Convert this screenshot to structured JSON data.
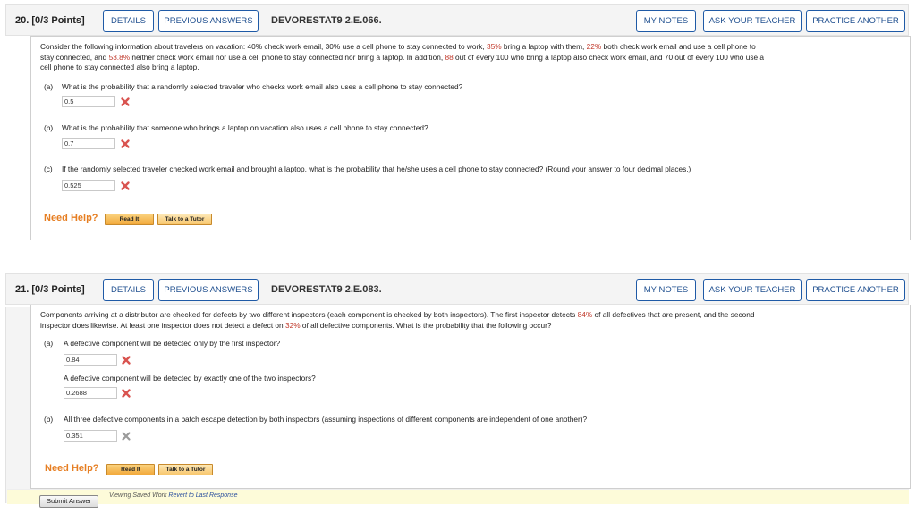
{
  "header_buttons": {
    "details": "DETAILS",
    "previous_answers": "PREVIOUS ANSWERS",
    "my_notes": "MY NOTES",
    "ask_teacher": "ASK YOUR TEACHER",
    "practice_another": "PRACTICE ANOTHER"
  },
  "need_help": {
    "label": "Need Help?",
    "read_it": "Read It",
    "talk_to_tutor": "Talk to a Tutor"
  },
  "q20": {
    "number": "20.",
    "points": "[0/3 Points]",
    "code": "DEVORESTAT9 2.E.066.",
    "intro_line1_a": "Consider the following information about travelers on vacation: 40% check work email, 30% use a cell phone to stay connected to work, ",
    "intro_pct_laptop": "35%",
    "intro_line1_b": " bring a laptop with them, ",
    "intro_pct_email_cell": "22%",
    "intro_line1_c": " both check work email and use a cell phone to",
    "intro_line2_a": "stay connected, and ",
    "intro_pct_neither": "53.8%",
    "intro_line2_b": " neither check work email nor use a cell phone to stay connected nor bring a laptop. In addition, ",
    "intro_n88": "88",
    "intro_line2_c": " out of every 100 who bring a laptop also check work email, and 70 out of every 100 who use a",
    "intro_line3": "cell phone to stay connected also bring a laptop.",
    "parts": [
      {
        "label": "(a)",
        "question": "What is the probability that a randomly selected traveler who checks work email also uses a cell phone to stay connected?",
        "answer": "0.5",
        "status": "incorrect"
      },
      {
        "label": "(b)",
        "question": "What is the probability that someone who brings a laptop on vacation also uses a cell phone to stay connected?",
        "answer": "0.7",
        "status": "incorrect"
      },
      {
        "label": "(c)",
        "question": "If the randomly selected traveler checked work email and brought a laptop, what is the probability that he/she uses a cell phone to stay connected? (Round your answer to four decimal places.)",
        "answer": "0.525",
        "status": "incorrect"
      }
    ]
  },
  "q21": {
    "number": "21.",
    "points": "[0/3 Points]",
    "code": "DEVORESTAT9 2.E.083.",
    "intro_line1_a": "Components arriving at a distributor are checked for defects by two different inspectors (each component is checked by both inspectors). The first inspector detects ",
    "intro_pct_first": "84%",
    "intro_line1_b": " of all defectives that are present, and the second",
    "intro_line2_a": "inspector does likewise. At least one inspector does not detect a defect on ",
    "intro_pct_miss": "32%",
    "intro_line2_b": " of all defective components. What is the probability that the following occur?",
    "parts": [
      {
        "label": "(a)",
        "question": "A defective component will be detected only by the first inspector?",
        "answer": "0.84",
        "status": "incorrect"
      },
      {
        "label": "",
        "question": "A defective component will be detected by exactly one of the two inspectors?",
        "answer": "0.2688",
        "status": "incorrect"
      },
      {
        "label": "(b)",
        "question": "All three defective components in a batch escape detection by both inspectors (assuming inspections of different components are independent of one another)?",
        "answer": "0.351",
        "status": "unanswered-mark"
      }
    ]
  },
  "footer": {
    "submit": "Submit Answer",
    "viewing": "Viewing Saved Work",
    "revert": "Revert to Last Response"
  },
  "colors": {
    "highlight_red": "#c0392b",
    "button_border": "#1f5aa6",
    "need_help_orange": "#e67e22",
    "x_red": "#d9534f",
    "x_gray": "#9a9a9a"
  }
}
